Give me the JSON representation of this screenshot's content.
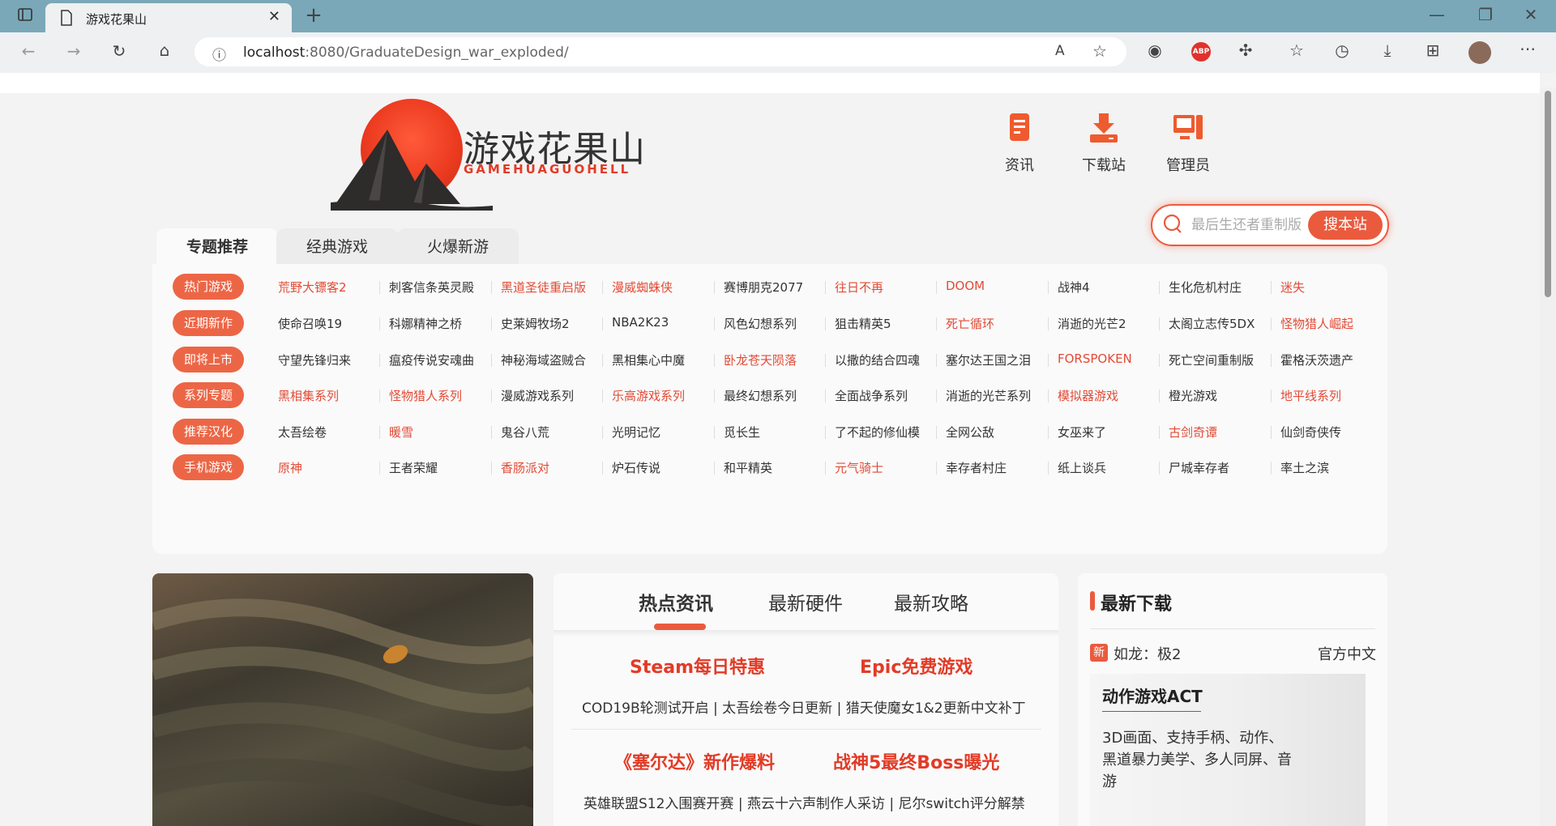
{
  "browser": {
    "tab_title": "游戏花果山",
    "url_host": "localhost",
    "url_rest": ":8080/GraduateDesign_war_exploded/",
    "icons": [
      "sidebar-icon",
      "page-icon",
      "close-icon",
      "plus-icon",
      "back-icon",
      "forward-icon",
      "refresh-icon",
      "home-icon",
      "info-icon",
      "read-aloud-icon",
      "favorite-add-icon",
      "extension-icon",
      "abp-icon",
      "puzzle-icon",
      "favorites-icon",
      "history-icon",
      "download-icon",
      "math-icon",
      "avatar",
      "more-icon",
      "minimize-icon",
      "restore-icon",
      "window-close-icon"
    ],
    "abp_label": "ABP"
  },
  "logo": {
    "title": "游戏花果山",
    "subtitle": "GAMEHUAGUOHELL"
  },
  "nav": [
    {
      "label": "资讯",
      "icon": "document-icon"
    },
    {
      "label": "下载站",
      "icon": "download-icon"
    },
    {
      "label": "管理员",
      "icon": "monitor-icon"
    }
  ],
  "search": {
    "placeholder": "最后生还者重制版",
    "button": "搜本站"
  },
  "topic_tabs": [
    "专题推荐",
    "经典游戏",
    "火爆新游"
  ],
  "topics": [
    {
      "category": "热门游戏",
      "items": [
        {
          "t": "荒野大镖客2",
          "red": true
        },
        {
          "t": "刺客信条英灵殿",
          "red": false
        },
        {
          "t": "黑道圣徒重启版",
          "red": true
        },
        {
          "t": "漫威蜘蛛侠",
          "red": true
        },
        {
          "t": "赛博朋克2077",
          "red": false
        },
        {
          "t": "往日不再",
          "red": true
        },
        {
          "t": "DOOM",
          "red": true
        },
        {
          "t": "战神4",
          "red": false
        },
        {
          "t": "生化危机村庄",
          "red": false
        },
        {
          "t": "迷失",
          "red": true
        }
      ]
    },
    {
      "category": "近期新作",
      "items": [
        {
          "t": "使命召唤19",
          "red": false
        },
        {
          "t": "科娜精神之桥",
          "red": false
        },
        {
          "t": "史莱姆牧场2",
          "red": false
        },
        {
          "t": "NBA2K23",
          "red": false
        },
        {
          "t": "风色幻想系列",
          "red": false
        },
        {
          "t": "狙击精英5",
          "red": false
        },
        {
          "t": "死亡循环",
          "red": true
        },
        {
          "t": "消逝的光芒2",
          "red": false
        },
        {
          "t": "太阁立志传5DX",
          "red": false
        },
        {
          "t": "怪物猎人崛起",
          "red": true
        }
      ]
    },
    {
      "category": "即将上市",
      "items": [
        {
          "t": "守望先锋归来",
          "red": false
        },
        {
          "t": "瘟疫传说安魂曲",
          "red": false
        },
        {
          "t": "神秘海域盗贼合",
          "red": false
        },
        {
          "t": "黑相集心中魔",
          "red": false
        },
        {
          "t": "卧龙苍天陨落",
          "red": true
        },
        {
          "t": "以撒的结合四魂",
          "red": false
        },
        {
          "t": "塞尔达王国之泪",
          "red": false
        },
        {
          "t": "FORSPOKEN",
          "red": true
        },
        {
          "t": "死亡空间重制版",
          "red": false
        },
        {
          "t": "霍格沃茨遗产",
          "red": false
        }
      ]
    },
    {
      "category": "系列专题",
      "items": [
        {
          "t": "黑相集系列",
          "red": true
        },
        {
          "t": "怪物猎人系列",
          "red": true
        },
        {
          "t": "漫威游戏系列",
          "red": false
        },
        {
          "t": "乐高游戏系列",
          "red": true
        },
        {
          "t": "最终幻想系列",
          "red": false
        },
        {
          "t": "全面战争系列",
          "red": false
        },
        {
          "t": "消逝的光芒系列",
          "red": false
        },
        {
          "t": "模拟器游戏",
          "red": true
        },
        {
          "t": "橙光游戏",
          "red": false
        },
        {
          "t": "地平线系列",
          "red": true
        }
      ]
    },
    {
      "category": "推荐汉化",
      "items": [
        {
          "t": "太吾绘卷",
          "red": false
        },
        {
          "t": "暖雪",
          "red": true
        },
        {
          "t": "鬼谷八荒",
          "red": false
        },
        {
          "t": "光明记忆",
          "red": false
        },
        {
          "t": "觅长生",
          "red": false
        },
        {
          "t": "了不起的修仙模",
          "red": false
        },
        {
          "t": "全网公敌",
          "red": false
        },
        {
          "t": "女巫来了",
          "red": false
        },
        {
          "t": "古剑奇谭",
          "red": true
        },
        {
          "t": "仙剑奇侠传",
          "red": false
        }
      ]
    },
    {
      "category": "手机游戏",
      "items": [
        {
          "t": "原神",
          "red": true
        },
        {
          "t": "王者荣耀",
          "red": false
        },
        {
          "t": "香肠派对",
          "red": true
        },
        {
          "t": "炉石传说",
          "red": false
        },
        {
          "t": "和平精英",
          "red": false
        },
        {
          "t": "元气骑士",
          "red": true
        },
        {
          "t": "幸存者村庄",
          "red": false
        },
        {
          "t": "纸上谈兵",
          "red": false
        },
        {
          "t": "尸城幸存者",
          "red": false
        },
        {
          "t": "率土之滨",
          "red": false
        }
      ]
    }
  ],
  "news": {
    "tabs": [
      "热点资讯",
      "最新硬件",
      "最新攻略"
    ],
    "headline1_left": "Steam每日特惠",
    "headline1_right": "Epic免费游戏",
    "line1": "COD19B轮测试开启  |  太吾绘卷今日更新  |  猎天使魔女1&2更新中文补丁",
    "headline2_left": "《塞尔达》新作爆料",
    "headline2_right": "战神5最终Boss曝光",
    "line2": "英雄联盟S12入围赛开赛  |  燕云十六声制作人采访  |  尼尔switch评分解禁"
  },
  "downloads": {
    "title": "最新下载",
    "badge": "新",
    "game": "如龙：极2",
    "tag": "官方中文",
    "card_title": "动作游戏ACT",
    "card_desc": "3D画面、支持手柄、动作、黑道暴力美学、多人同屏、音游"
  }
}
